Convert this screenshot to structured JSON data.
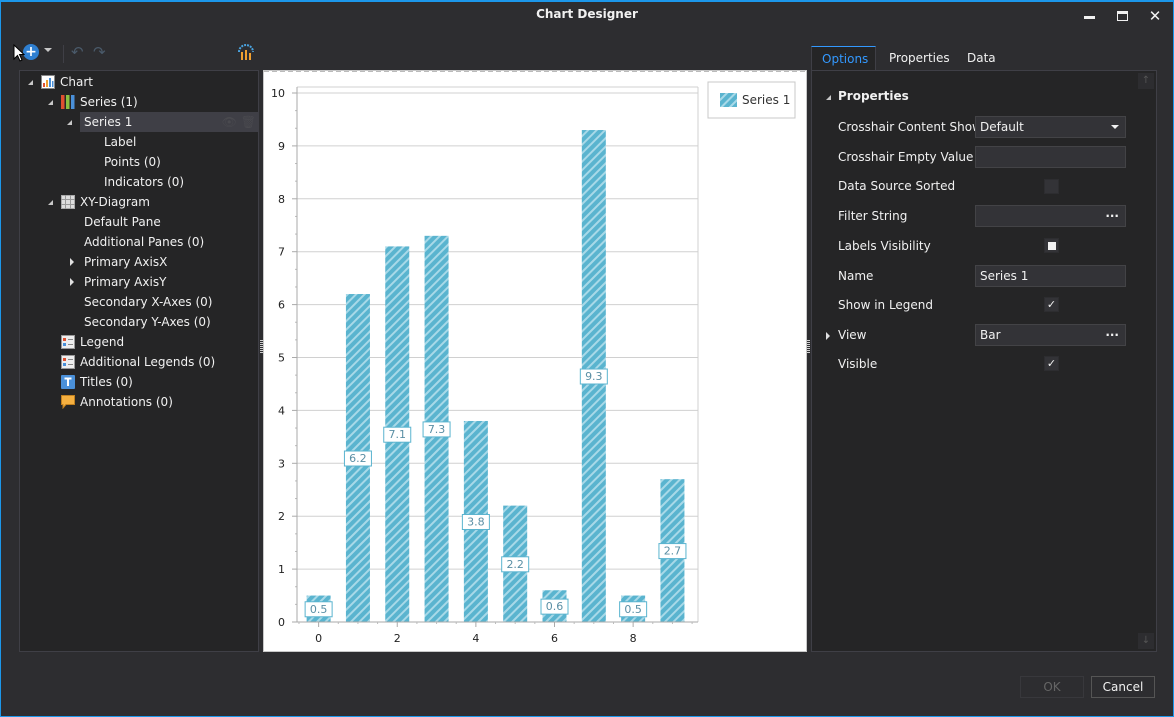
{
  "window": {
    "title": "Chart Designer",
    "buttons": {
      "minimize": "minimize",
      "maximize": "maximize",
      "close": "close"
    }
  },
  "toolbar": {
    "add_icon": "add-circle-icon",
    "dropdown_icon": "chevron-down-icon",
    "undo_icon": "undo-icon",
    "redo_icon": "redo-icon",
    "wizard_icon": "chart-wizard-icon"
  },
  "tree": {
    "items": [
      {
        "label": "Chart",
        "icon": "chart-icon",
        "expanded": true,
        "level": 0
      },
      {
        "label": "Series (1)",
        "icon": "series-icon",
        "expanded": true,
        "level": 1
      },
      {
        "label": "Series 1",
        "expanded": true,
        "level": 2,
        "selected": true
      },
      {
        "label": "Label",
        "level": 3
      },
      {
        "label": "Points (0)",
        "level": 3
      },
      {
        "label": "Indicators (0)",
        "level": 3
      },
      {
        "label": "XY-Diagram",
        "icon": "diagram-grid-icon",
        "expanded": true,
        "level": 1
      },
      {
        "label": "Default Pane",
        "level": 2
      },
      {
        "label": "Additional Panes (0)",
        "level": 2
      },
      {
        "label": "Primary AxisX",
        "level": 2,
        "collapsed": true
      },
      {
        "label": "Primary AxisY",
        "level": 2,
        "collapsed": true
      },
      {
        "label": "Secondary X-Axes (0)",
        "level": 2
      },
      {
        "label": "Secondary Y-Axes (0)",
        "level": 2
      },
      {
        "label": "Legend",
        "icon": "legend-icon",
        "level": 1
      },
      {
        "label": "Additional Legends (0)",
        "icon": "legend-icon",
        "level": 1
      },
      {
        "label": "Titles (0)",
        "icon": "title-icon",
        "level": 1
      },
      {
        "label": "Annotations (0)",
        "icon": "annotation-icon",
        "level": 1
      }
    ]
  },
  "chart_data": {
    "type": "bar",
    "title": "",
    "xlabel": "",
    "ylabel": "",
    "x": [
      0,
      1,
      2,
      3,
      4,
      5,
      6,
      7,
      8,
      9
    ],
    "series": [
      {
        "name": "Series 1",
        "values": [
          0.5,
          6.2,
          7.1,
          7.3,
          3.8,
          2.2,
          0.6,
          9.3,
          0.5,
          2.7
        ],
        "color": "#5ab4cf",
        "pattern": "diagonal-hatch"
      }
    ],
    "data_labels": [
      "0.5",
      "6.2",
      "7.1",
      "7.3",
      "3.8",
      "2.2",
      "0.6",
      "9.3",
      "0.5",
      "2.7"
    ],
    "xticks": [
      "0",
      "2",
      "4",
      "6",
      "8"
    ],
    "yticks": [
      "0",
      "1",
      "2",
      "3",
      "4",
      "5",
      "6",
      "7",
      "8",
      "9",
      "10"
    ],
    "xlim": [
      -0.55,
      9.65
    ],
    "ylim": [
      0,
      10
    ],
    "grid": "horizontal",
    "legend": {
      "entries": [
        "Series 1"
      ],
      "placement": "top-right"
    }
  },
  "tabs": [
    {
      "label": "Options",
      "active": true
    },
    {
      "label": "Properties",
      "active": false
    },
    {
      "label": "Data",
      "active": false
    }
  ],
  "properties": {
    "group": "Properties",
    "rows": [
      {
        "label": "Crosshair Content Show...",
        "type": "dropdown",
        "value": "Default"
      },
      {
        "label": "Crosshair Empty Value L...",
        "type": "text",
        "value": ""
      },
      {
        "label": "Data Source Sorted",
        "type": "checkbox",
        "value": "unchecked"
      },
      {
        "label": "Filter String",
        "type": "ellipsis",
        "value": ""
      },
      {
        "label": "Labels Visibility",
        "type": "checkbox",
        "value": "indeterminate"
      },
      {
        "label": "Name",
        "type": "text",
        "value": "Series 1"
      },
      {
        "label": "Show in Legend",
        "type": "checkbox",
        "value": "checked"
      },
      {
        "label": "View",
        "type": "ellipsis",
        "value": "Bar",
        "expandable": true
      },
      {
        "label": "Visible",
        "type": "checkbox",
        "value": "checked"
      }
    ],
    "ellipsis_glyph": "···",
    "check_glyph": "✓"
  },
  "footer": {
    "ok_label": "OK",
    "cancel_label": "Cancel"
  }
}
